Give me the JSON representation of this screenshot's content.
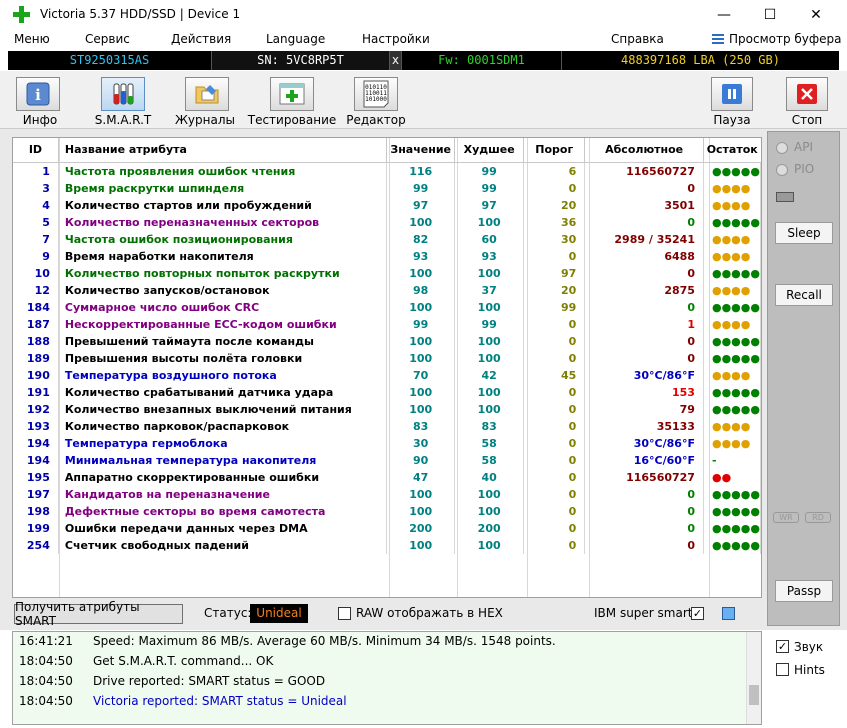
{
  "window": {
    "title": "Victoria 5.37 HDD/SSD | Device 1",
    "minimize": "—",
    "maximize": "☐",
    "close": "✕"
  },
  "menu": {
    "items": [
      "Меню",
      "Сервис",
      "Действия",
      "Language",
      "Настройки",
      "Справка"
    ],
    "buffer_label": "Просмотр буфера"
  },
  "infobar": {
    "model": "ST9250315AS",
    "serial": "SN: 5VC8RP5T",
    "x": "x",
    "firmware": "Fw: 0001SDM1",
    "lba": "488397168 LBA (250 GB)"
  },
  "toolbar": {
    "info": "Инфо",
    "smart": "S.M.A.R.T",
    "logs": "Журналы",
    "test": "Тестирование",
    "editor": "Редактор",
    "pause": "Пауза",
    "stop": "Стоп"
  },
  "table": {
    "headers": {
      "id": "ID",
      "name": "Название атрибута",
      "value": "Значение",
      "worst": "Худшее",
      "threshold": "Порог",
      "absolute": "Абсолютное",
      "remaining": "Остаток"
    },
    "rows": [
      {
        "id": "1",
        "name": "Частота проявления ошибок чтения",
        "value": "116",
        "worst": "99",
        "thr": "6",
        "abs": "116560727",
        "rem": "●●●●●",
        "name_color": "#007000",
        "thr_color": "#808000",
        "abs_color": "#800000",
        "rem_color": "#008000"
      },
      {
        "id": "3",
        "name": "Время раскрутки шпинделя",
        "value": "99",
        "worst": "99",
        "thr": "0",
        "abs": "0",
        "rem": "●●●●",
        "name_color": "#007000",
        "thr_color": "#808000",
        "abs_color": "#800000",
        "rem_color": "#e0a000"
      },
      {
        "id": "4",
        "name": "Количество стартов или пробуждений",
        "value": "97",
        "worst": "97",
        "thr": "20",
        "abs": "3501",
        "rem": "●●●●",
        "name_color": "#000000",
        "thr_color": "#808000",
        "abs_color": "#800000",
        "rem_color": "#e0a000"
      },
      {
        "id": "5",
        "name": "Количество переназначенных секторов",
        "value": "100",
        "worst": "100",
        "thr": "36",
        "abs": "0",
        "rem": "●●●●●",
        "name_color": "#800080",
        "thr_color": "#808000",
        "abs_color": "#008000",
        "rem_color": "#008000"
      },
      {
        "id": "7",
        "name": "Частота ошибок позиционирования",
        "value": "82",
        "worst": "60",
        "thr": "30",
        "abs": "2989 / 35241",
        "rem": "●●●●",
        "name_color": "#007000",
        "thr_color": "#808000",
        "abs_color": "#800000",
        "rem_color": "#e0a000"
      },
      {
        "id": "9",
        "name": "Время наработки накопителя",
        "value": "93",
        "worst": "93",
        "thr": "0",
        "abs": "6488",
        "rem": "●●●●",
        "name_color": "#000000",
        "thr_color": "#808000",
        "abs_color": "#800000",
        "rem_color": "#e0a000"
      },
      {
        "id": "10",
        "name": "Количество повторных попыток раскрутки",
        "value": "100",
        "worst": "100",
        "thr": "97",
        "abs": "0",
        "rem": "●●●●●",
        "name_color": "#007000",
        "thr_color": "#808000",
        "abs_color": "#800000",
        "rem_color": "#008000"
      },
      {
        "id": "12",
        "name": "Количество запусков/остановок",
        "value": "98",
        "worst": "37",
        "thr": "20",
        "abs": "2875",
        "rem": "●●●●",
        "name_color": "#000000",
        "thr_color": "#808000",
        "abs_color": "#800000",
        "rem_color": "#e0a000"
      },
      {
        "id": "184",
        "name": "Суммарное число ошибок CRC",
        "value": "100",
        "worst": "100",
        "thr": "99",
        "abs": "0",
        "rem": "●●●●●",
        "name_color": "#800080",
        "thr_color": "#808000",
        "abs_color": "#008000",
        "rem_color": "#008000"
      },
      {
        "id": "187",
        "name": "Нескорректированные ECC-кодом ошибки",
        "value": "99",
        "worst": "99",
        "thr": "0",
        "abs": "1",
        "rem": "●●●●",
        "name_color": "#800080",
        "thr_color": "#808000",
        "abs_color": "#e00000",
        "rem_color": "#e0a000"
      },
      {
        "id": "188",
        "name": "Превышений таймаута после команды",
        "value": "100",
        "worst": "100",
        "thr": "0",
        "abs": "0",
        "rem": "●●●●●",
        "name_color": "#000000",
        "thr_color": "#808000",
        "abs_color": "#800000",
        "rem_color": "#008000"
      },
      {
        "id": "189",
        "name": "Превышения высоты полёта головки",
        "value": "100",
        "worst": "100",
        "thr": "0",
        "abs": "0",
        "rem": "●●●●●",
        "name_color": "#000000",
        "thr_color": "#808000",
        "abs_color": "#800000",
        "rem_color": "#008000"
      },
      {
        "id": "190",
        "name": "Температура воздушного потока",
        "value": "70",
        "worst": "42",
        "thr": "45",
        "abs": "30°C/86°F",
        "rem": "●●●●",
        "name_color": "#0000c0",
        "thr_color": "#808000",
        "abs_color": "#0000c0",
        "rem_color": "#e0a000"
      },
      {
        "id": "191",
        "name": "Количество срабатываний датчика удара",
        "value": "100",
        "worst": "100",
        "thr": "0",
        "abs": "153",
        "rem": "●●●●●",
        "name_color": "#000000",
        "thr_color": "#808000",
        "abs_color": "#e00000",
        "rem_color": "#008000"
      },
      {
        "id": "192",
        "name": "Количество внезапных выключений питания",
        "value": "100",
        "worst": "100",
        "thr": "0",
        "abs": "79",
        "rem": "●●●●●",
        "name_color": "#000000",
        "thr_color": "#808000",
        "abs_color": "#800000",
        "rem_color": "#008000"
      },
      {
        "id": "193",
        "name": "Количество парковок/распарковок",
        "value": "83",
        "worst": "83",
        "thr": "0",
        "abs": "35133",
        "rem": "●●●●",
        "name_color": "#000000",
        "thr_color": "#808000",
        "abs_color": "#800000",
        "rem_color": "#e0a000"
      },
      {
        "id": "194",
        "name": "Температура гермоблока",
        "value": "30",
        "worst": "58",
        "thr": "0",
        "abs": "30°C/86°F",
        "rem": "●●●●",
        "name_color": "#0000c0",
        "thr_color": "#808000",
        "abs_color": "#0000c0",
        "rem_color": "#e0a000"
      },
      {
        "id": "194",
        "name": "Минимальная температура накопителя",
        "value": "90",
        "worst": "58",
        "thr": "0",
        "abs": "16°C/60°F",
        "rem": "-",
        "name_color": "#0000c0",
        "thr_color": "#808000",
        "abs_color": "#0000c0",
        "rem_color": "#008000"
      },
      {
        "id": "195",
        "name": "Аппаратно скорректированные ошибки",
        "value": "47",
        "worst": "40",
        "thr": "0",
        "abs": "116560727",
        "rem": "●●",
        "name_color": "#000000",
        "thr_color": "#808000",
        "abs_color": "#800000",
        "rem_color": "#e00000"
      },
      {
        "id": "197",
        "name": "Кандидатов на переназначение",
        "value": "100",
        "worst": "100",
        "thr": "0",
        "abs": "0",
        "rem": "●●●●●",
        "name_color": "#800080",
        "thr_color": "#808000",
        "abs_color": "#008000",
        "rem_color": "#008000"
      },
      {
        "id": "198",
        "name": "Дефектные секторы во время самотеста",
        "value": "100",
        "worst": "100",
        "thr": "0",
        "abs": "0",
        "rem": "●●●●●",
        "name_color": "#800080",
        "thr_color": "#808000",
        "abs_color": "#008000",
        "rem_color": "#008000"
      },
      {
        "id": "199",
        "name": "Ошибки передачи данных через DMA",
        "value": "200",
        "worst": "200",
        "thr": "0",
        "abs": "0",
        "rem": "●●●●●",
        "name_color": "#000000",
        "thr_color": "#808000",
        "abs_color": "#008000",
        "rem_color": "#008000"
      },
      {
        "id": "254",
        "name": "Счетчик свободных падений",
        "value": "100",
        "worst": "100",
        "thr": "0",
        "abs": "0",
        "rem": "●●●●●",
        "name_color": "#000000",
        "thr_color": "#808000",
        "abs_color": "#800000",
        "rem_color": "#008000"
      }
    ]
  },
  "right_panel": {
    "api": "API",
    "pio": "PIO",
    "sleep": "Sleep",
    "recall": "Recall",
    "wr": "WR",
    "rd": "RD",
    "passp": "Passp"
  },
  "status": {
    "get_attrs": "Получить атрибуты SMART",
    "status_label": "Статус:",
    "status_value": "Unideal",
    "raw_hex": "RAW отображать в HEX",
    "ibm": "IBM super smart:",
    "ibm_checked": "✓"
  },
  "log": [
    {
      "time": "16:41:21",
      "msg": "Speed: Maximum 86 MB/s. Average 60 MB/s. Minimum 34 MB/s. 1548 points.",
      "color": "#000000"
    },
    {
      "time": "18:04:50",
      "msg": "Get S.M.A.R.T. command... OK",
      "color": "#000000"
    },
    {
      "time": "18:04:50",
      "msg": "Drive reported: SMART status = GOOD",
      "color": "#000000"
    },
    {
      "time": "18:04:50",
      "msg": "Victoria reported: SMART status = Unideal",
      "color": "#0000c0"
    }
  ],
  "side_options": {
    "sound": "Звук",
    "sound_checked": "✓",
    "hints": "Hints"
  }
}
